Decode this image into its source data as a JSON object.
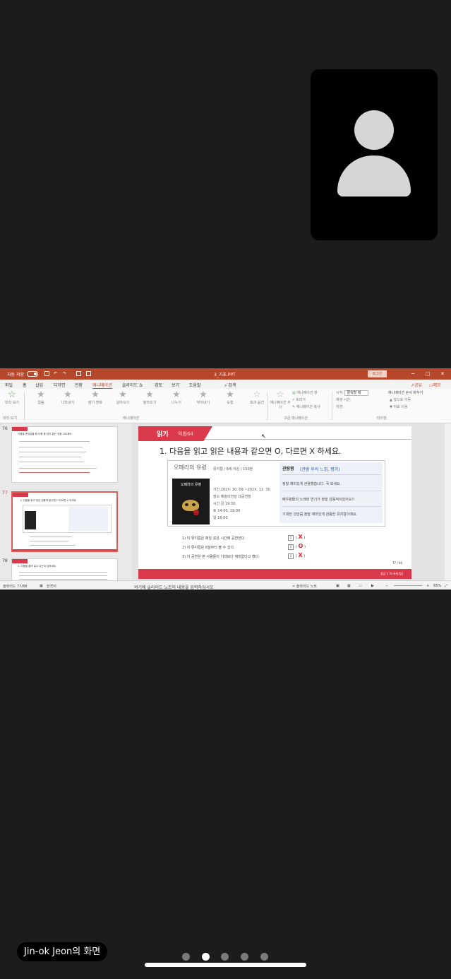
{
  "participant": {
    "avatar": "person-avatar-icon"
  },
  "ppt": {
    "titlebar": {
      "autosave": "자동 저장",
      "filename": "3_기초.PPT",
      "login": "로그인",
      "minimize": "─",
      "restore": "□",
      "close": "✕"
    },
    "menu": [
      "파일",
      "홈",
      "삽입",
      "디자인",
      "전환",
      "애니메이션",
      "슬라이드 쇼",
      "검토",
      "보기",
      "도움말"
    ],
    "menu_search": "검색",
    "share": "공유",
    "memo": "메모",
    "ribbon": {
      "preview": "미리 보기",
      "effects": [
        "없음",
        "나타내기",
        "밝기 변화",
        "날아오기",
        "올라오기",
        "나누기",
        "닦아내기",
        "도형"
      ],
      "effect_options": "효과 옵션",
      "add_animation": "애니메이션 추가",
      "animation_pane": "애니메이션 창",
      "trigger": "트리거",
      "anim_painter": "애니메이션 복사",
      "start_label": "시작:",
      "start_value": "클릭할 때",
      "duration_label": "재생 시간:",
      "delay_label": "지연:",
      "reorder": "애니메이션 순서 바꾸기",
      "move_earlier": "앞으로 이동",
      "move_later": "뒤로 이동",
      "group_animation": "애니메이션",
      "group_advanced": "고급 애니메이션",
      "group_timing": "타이밍",
      "group_preview": "미리 보기"
    },
    "thumbnails": [
      {
        "num": "76",
        "title": "다음을 준읽었을 때 다음 중 답이 없는 것을 고르세요."
      },
      {
        "num": "77",
        "title": "1. 다음을 읽고 읽은 내용과 같으면 O 다르면 X 하세요."
      },
      {
        "num": "78",
        "title": "2. 다음을 출력 읽고 있는지 답하세요."
      }
    ],
    "slide": {
      "header": "읽기",
      "header_sub": "익힘64",
      "question": "1. 다음을 읽고 읽은 내용과 같으면 O, 다르면 X 하세요.",
      "poster_title": "오페라의 유령",
      "poster_caption": "오페라의 유령",
      "info": [
        "뮤지컬 / 8세 이상 / 150분",
        "기간  202X. 10. 09.~202X. 12. 30.",
        "장소  예술의전당 대공연장",
        "시간  금 19:30",
        "        토 14:00, 19:00",
        "        일 16:00"
      ],
      "review_title": "관람평",
      "review_subtitle": "(관람 후의 느낌, 평가)",
      "reviews": [
        "정말 재미있게 관람했습니다. 꼭 보세요.",
        "배우분들의 노래와 연기가 정말 감동적이었어요!!",
        "기대한 것만큼 정말 재미있게 관람한 뮤지컬이에요."
      ],
      "statements": [
        {
          "text": "1)  이 뮤지컬은 매일 같은 시간에 공연한다.",
          "box": "1",
          "answer": "X"
        },
        {
          "text": "2)  이 뮤지컬은 8살부터 볼 수 있다.",
          "box": "2",
          "answer": "O"
        },
        {
          "text": "3)  이 공연은 본 사람들이 기대보다 재미없다고 했다.",
          "box": "3",
          "answer": "X"
        }
      ],
      "page": "77 / 94",
      "footer_label": "중급 1 Te-초미(임)"
    },
    "notes_placeholder": "여기에 슬라이드 노트의 내용을 입력하십시오",
    "status": {
      "slide_counter": "슬라이드 77/88",
      "language": "한국어",
      "notes_button": "슬라이드 노트",
      "zoom": "65%"
    }
  },
  "presenter_label": "Jin-ok Jeon의 화면",
  "pages": {
    "count": 5,
    "active": 1
  }
}
